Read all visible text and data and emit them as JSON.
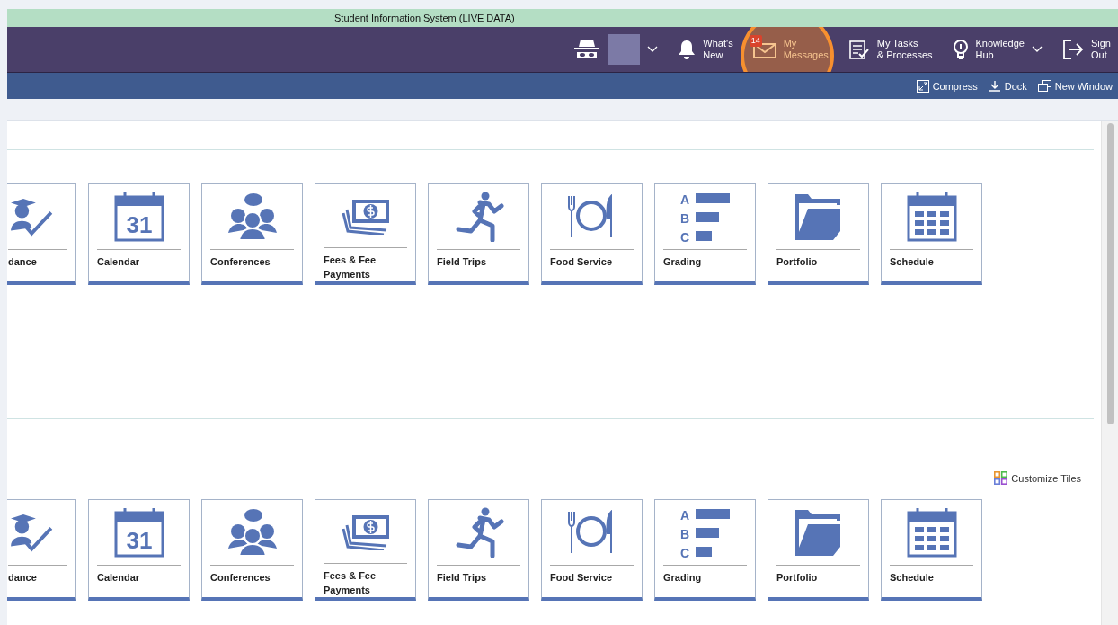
{
  "banner": {
    "title": "Student Information System (LIVE DATA)"
  },
  "header": {
    "nav": [
      {
        "kind": "identity"
      },
      {
        "kind": "bell",
        "label": [
          "What's",
          "New"
        ]
      },
      {
        "kind": "mail",
        "label": [
          "My",
          "Messages"
        ],
        "badge": "14",
        "highlighted": true
      },
      {
        "kind": "tasks",
        "label": [
          "My Tasks",
          "& Processes"
        ]
      },
      {
        "kind": "help",
        "label": [
          "Knowledge",
          "Hub"
        ],
        "dropdown": true
      },
      {
        "kind": "signout",
        "label": [
          "Sign",
          "Out"
        ]
      }
    ]
  },
  "toolbar": {
    "actions": [
      {
        "kind": "compress",
        "label": "Compress"
      },
      {
        "kind": "dock",
        "label": "Dock"
      },
      {
        "kind": "window",
        "label": "New Window"
      }
    ]
  },
  "sections": [
    {
      "tiles": [
        {
          "kind": "attendance",
          "label": "dance"
        },
        {
          "kind": "calendar",
          "label": "Calendar",
          "day": "31"
        },
        {
          "kind": "people",
          "label": "Conferences"
        },
        {
          "kind": "money",
          "label": "Fees & Fee Payments"
        },
        {
          "kind": "runner",
          "label": "Field Trips"
        },
        {
          "kind": "food",
          "label": "Food Service"
        },
        {
          "kind": "grades",
          "label": "Grading",
          "letters": [
            "A",
            "B",
            "C"
          ]
        },
        {
          "kind": "folder",
          "label": "Portfolio"
        },
        {
          "kind": "schedule",
          "label": "Schedule"
        }
      ]
    },
    {
      "customize": "Customize Tiles",
      "tiles": [
        {
          "kind": "attendance",
          "label": "dance"
        },
        {
          "kind": "calendar",
          "label": "Calendar",
          "day": "31"
        },
        {
          "kind": "people",
          "label": "Conferences"
        },
        {
          "kind": "money",
          "label": "Fees & Fee Payments"
        },
        {
          "kind": "runner",
          "label": "Field Trips"
        },
        {
          "kind": "food",
          "label": "Food Service"
        },
        {
          "kind": "grades",
          "label": "Grading",
          "letters": [
            "A",
            "B",
            "C"
          ]
        },
        {
          "kind": "folder",
          "label": "Portfolio"
        },
        {
          "kind": "schedule",
          "label": "Schedule"
        }
      ]
    }
  ]
}
